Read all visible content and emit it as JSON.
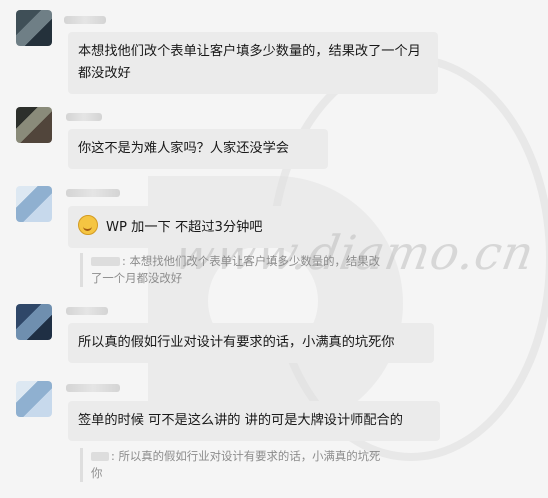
{
  "watermark": {
    "text": "www.diamo.cn"
  },
  "messages": [
    {
      "text": "本想找他们改个表单让客户填多少数量的，结果改了一个月都没改好"
    },
    {
      "text": "你这不是为难人家吗？人家还没学会"
    },
    {
      "text": "WP 加一下 不超过3分钟吧",
      "quote": ": 本想找他们改个表单让客户填多少数量的，结果改了一个月都没改好"
    },
    {
      "text": "所以真的假如行业对设计有要求的话，小满真的坑死你"
    },
    {
      "text": "签单的时候 可不是这么讲的   讲的可是大牌设计师配合的",
      "quote": ": 所以真的假如行业对设计有要求的话，小满真的坑死你"
    }
  ]
}
